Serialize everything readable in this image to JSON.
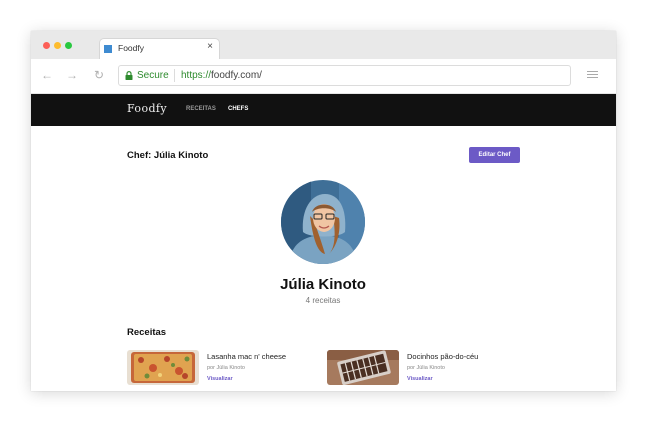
{
  "browser": {
    "tab_title": "Foodfy",
    "tab_close": "×",
    "secure_label": "Secure",
    "url_scheme": "https://",
    "url_rest": "foodfy.com/",
    "icons": {
      "back": "←",
      "forward": "→",
      "reload": "↻"
    }
  },
  "navbar": {
    "logo": "Foodfy",
    "links": [
      {
        "label": "RECEITAS",
        "active": false
      },
      {
        "label": "CHEFS",
        "active": true
      }
    ]
  },
  "page": {
    "heading": "Chef: Júlia Kinoto",
    "edit_button": "Editar Chef"
  },
  "chef": {
    "name": "Júlia Kinoto",
    "recipe_count": "4 receitas"
  },
  "recipes_section": {
    "title": "Receitas",
    "items": [
      {
        "title": "Lasanha mac n' cheese",
        "author": "por Júlia Kinoto",
        "link": "Visualizar"
      },
      {
        "title": "Docinhos pão-do-céu",
        "author": "por Júlia Kinoto",
        "link": "Visualizar"
      }
    ]
  },
  "colors": {
    "accent": "#6c5ac6",
    "navbar_bg": "#111111",
    "secure_green": "#2e8b2e"
  }
}
